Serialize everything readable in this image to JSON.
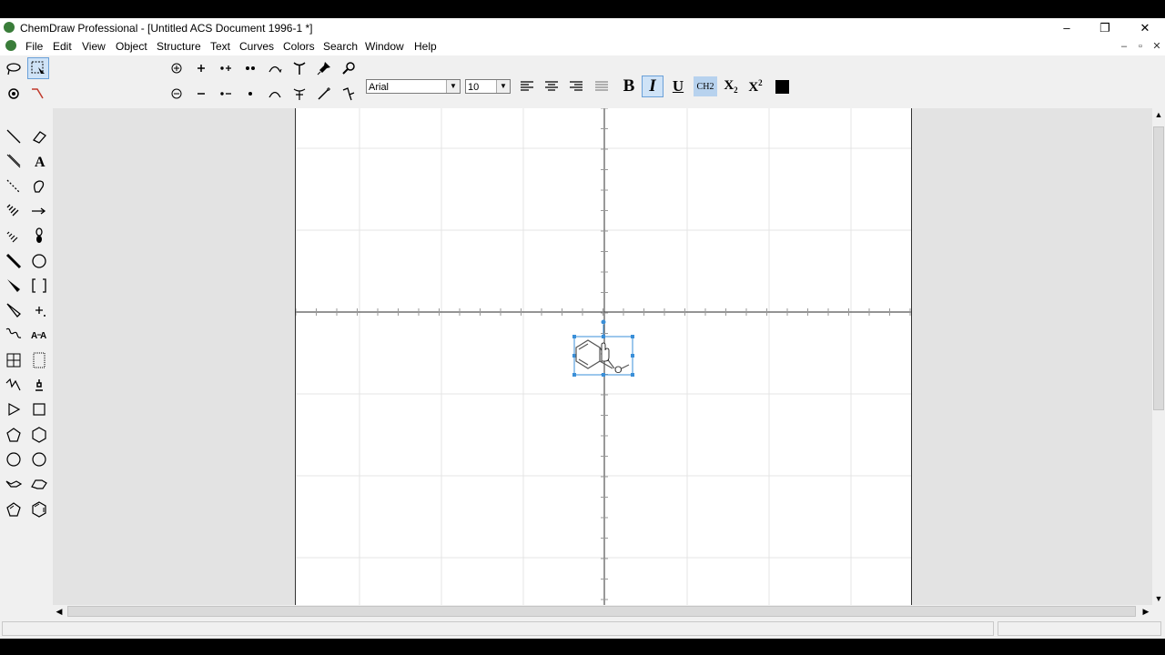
{
  "window": {
    "title": "ChemDraw Professional - [Untitled ACS Document 1996-1 *]",
    "controls": {
      "minimize": "–",
      "restore": "❐",
      "close": "✕"
    },
    "mdi_controls": {
      "minimize": "–",
      "restore": "▫",
      "close": "✕"
    }
  },
  "menu": [
    "File",
    "Edit",
    "View",
    "Object",
    "Structure",
    "Text",
    "Curves",
    "Colors",
    "Search",
    "Window",
    "Help"
  ],
  "toolbar": {
    "font_name": "Arial",
    "font_size": "10",
    "bold_label": "B",
    "italic_label": "I",
    "underline_label": "U",
    "formula_label": "CH2",
    "subscript_label": "X2",
    "superscript_label": "X2"
  },
  "canvas": {
    "molecule_atom_label": "O",
    "selection": "benzofuran-like ring fragment selected"
  },
  "colors": {
    "accent": "#3a8fd8",
    "selection_fill": "#cfe3f7"
  }
}
